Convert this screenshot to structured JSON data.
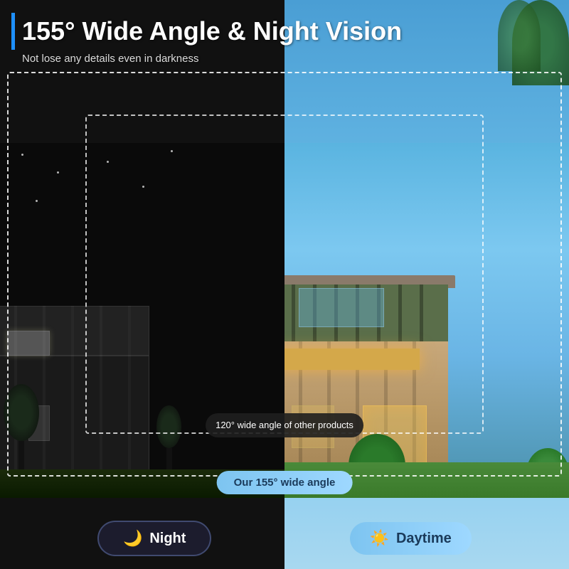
{
  "header": {
    "title": "155° Wide Angle & Night Vision",
    "subtitle": "Not lose any details even in darkness"
  },
  "tooltips": {
    "inner_label": "120° wide angle of\nother products",
    "outer_label": "Our 155° wide angle"
  },
  "buttons": {
    "night_label": "Night",
    "day_label": "Daytime"
  },
  "colors": {
    "accent_blue": "#1e90ff",
    "night_bg": "#111111",
    "day_bg": "#5ab4e0",
    "btn_night_bg": "rgba(30,30,50,0.85)",
    "btn_day_bg": "#7dc4f0"
  },
  "icons": {
    "night": "🌙",
    "day": "🌤️"
  }
}
